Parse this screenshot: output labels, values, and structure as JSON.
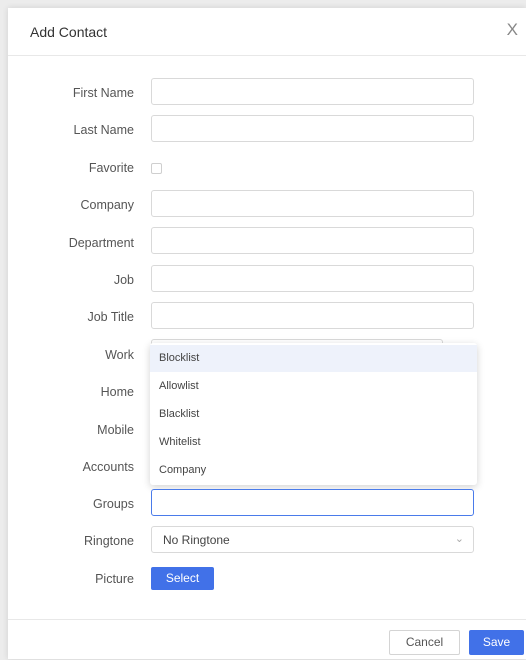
{
  "dialog": {
    "title": "Add Contact",
    "close_symbol": "X"
  },
  "form": {
    "first_name_label": "First Name",
    "last_name_label": "Last Name",
    "favorite_label": "Favorite",
    "company_label": "Company",
    "department_label": "Department",
    "job_label": "Job",
    "job_title_label": "Job Title",
    "work_label": "Work",
    "home_label": "Home",
    "mobile_label": "Mobile",
    "accounts_label": "Accounts",
    "groups_label": "Groups",
    "ringtone_label": "Ringtone",
    "ringtone_value": "No Ringtone",
    "picture_label": "Picture",
    "picture_button": "Select"
  },
  "groups_dropdown": {
    "options": [
      "Blocklist",
      "Allowlist",
      "Blacklist",
      "Whitelist",
      "Company"
    ],
    "highlighted": "Blocklist"
  },
  "footer": {
    "cancel_label": "Cancel",
    "save_label": "Save"
  },
  "colors": {
    "accent": "#4171e8",
    "focus_border": "#4a7bea",
    "highlight_row": "#eef2fb"
  },
  "icons": {
    "close": "close-icon",
    "ringtone_chevron": "chevron-down-icon"
  }
}
